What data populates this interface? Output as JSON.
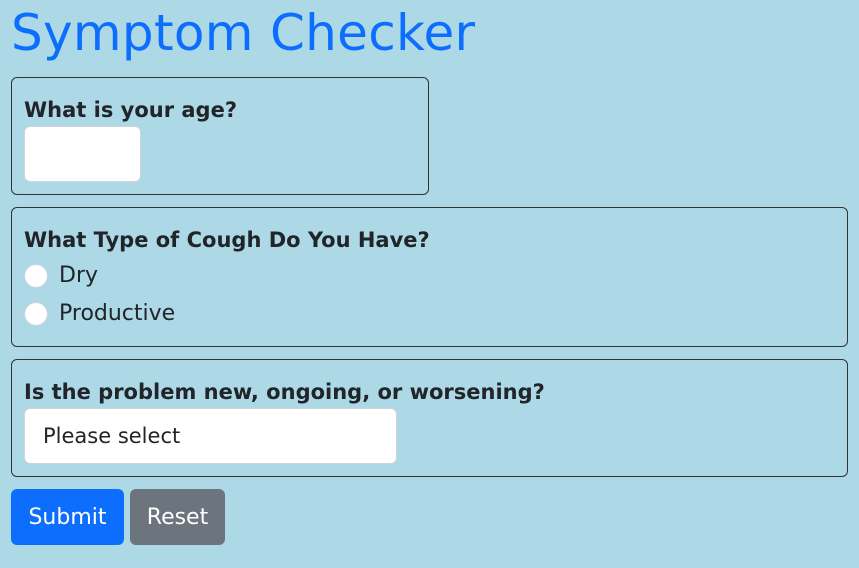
{
  "title": "Symptom Checker",
  "age": {
    "label": "What is your age?",
    "value": ""
  },
  "cough": {
    "label": "What Type of Cough Do You Have?",
    "options": [
      "Dry",
      "Productive"
    ]
  },
  "problem": {
    "label": "Is the problem new, ongoing, or worsening?",
    "selected": "Please select"
  },
  "buttons": {
    "submit": "Submit",
    "reset": "Reset"
  },
  "colors": {
    "background": "#add8e6",
    "title": "#0d6efd",
    "submit": "#0d6efd",
    "reset": "#6c757d"
  }
}
